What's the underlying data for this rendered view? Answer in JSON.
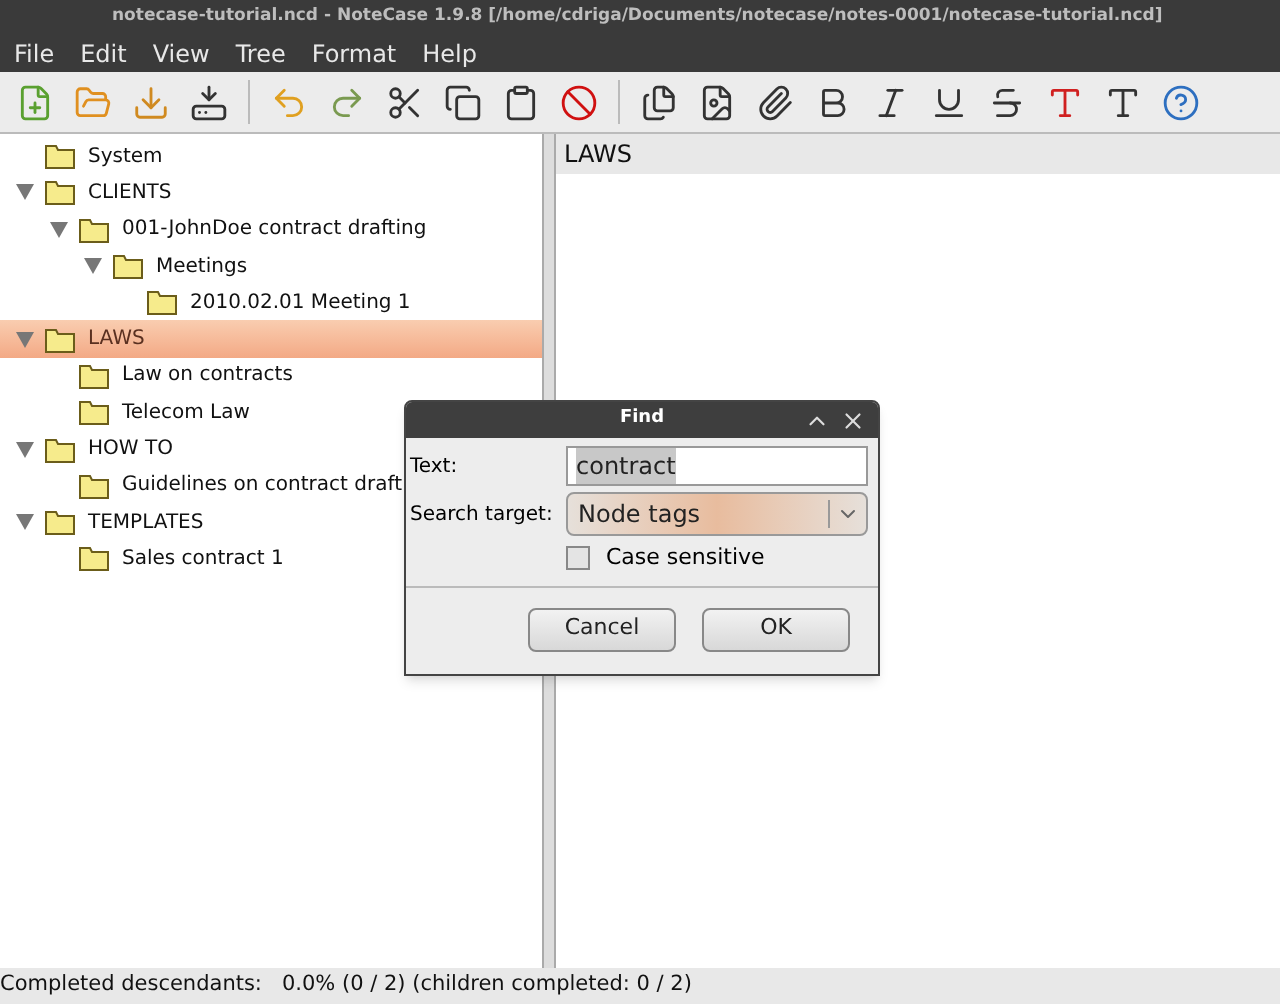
{
  "window": {
    "title": "notecase-tutorial.ncd - NoteCase 1.9.8 [/home/cdriga/Documents/notecase/notes-0001/notecase-tutorial.ncd]"
  },
  "menu": [
    "File",
    "Edit",
    "View",
    "Tree",
    "Format",
    "Help"
  ],
  "tree": [
    {
      "label": "System",
      "selected": false
    },
    {
      "label": "CLIENTS",
      "selected": false,
      "expanded": true,
      "children": [
        {
          "label": "001-JohnDoe contract drafting",
          "selected": false,
          "expanded": true,
          "children": [
            {
              "label": "Meetings",
              "selected": false,
              "expanded": true,
              "children": [
                {
                  "label": "2010.02.01 Meeting 1",
                  "selected": false
                }
              ]
            }
          ]
        }
      ]
    },
    {
      "label": "LAWS",
      "selected": true,
      "expanded": true,
      "children": [
        {
          "label": "Law on contracts",
          "selected": false
        },
        {
          "label": "Telecom Law",
          "selected": false
        }
      ]
    },
    {
      "label": "HOW TO",
      "selected": false,
      "expanded": true,
      "children": [
        {
          "label": "Guidelines on contract draft",
          "selected": false
        }
      ]
    },
    {
      "label": "TEMPLATES",
      "selected": false,
      "expanded": true,
      "children": [
        {
          "label": "Sales contract 1",
          "selected": false
        }
      ]
    }
  ],
  "editor": {
    "title": "LAWS"
  },
  "dialog": {
    "title": "Find",
    "text_label": "Text:",
    "text_value": "contract",
    "target_label": "Search target:",
    "target_value": "Node tags",
    "case_sensitive": {
      "label": "Case sensitive",
      "checked": false
    },
    "buttons": [
      "Cancel",
      "OK"
    ]
  },
  "status_bar": "Completed descendants:   0.0% (0 / 2) (children completed: 0 / 2)"
}
